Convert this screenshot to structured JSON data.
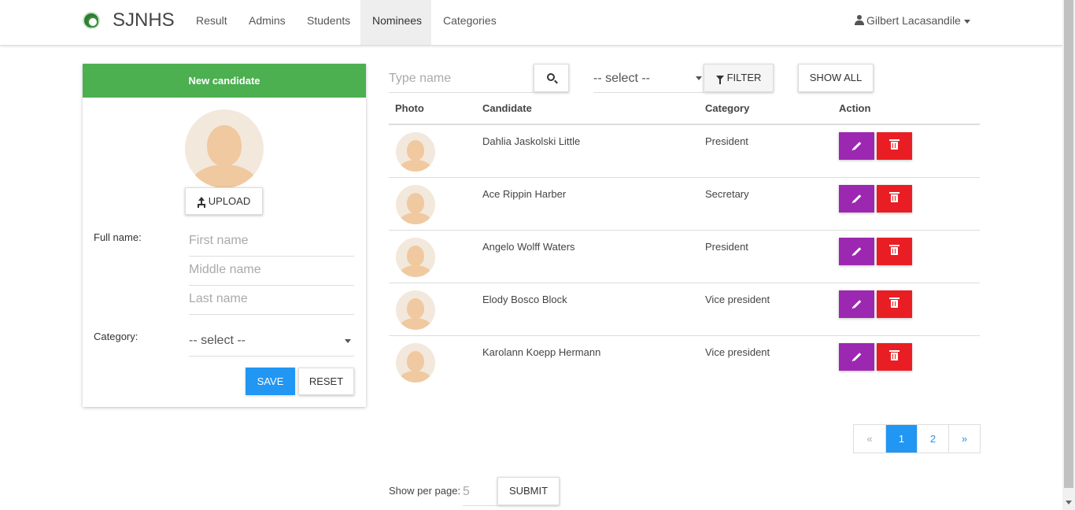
{
  "navbar": {
    "brand": "SJNHS",
    "items": [
      {
        "label": "Result",
        "active": false
      },
      {
        "label": "Admins",
        "active": false
      },
      {
        "label": "Students",
        "active": false
      },
      {
        "label": "Nominees",
        "active": true
      },
      {
        "label": "Categories",
        "active": false
      }
    ],
    "user": "Gilbert Lacasandile"
  },
  "form": {
    "header": "New candidate",
    "upload_label": "UPLOAD",
    "fullname_label": "Full name:",
    "first_placeholder": "First name",
    "middle_placeholder": "Middle name",
    "last_placeholder": "Last name",
    "category_label": "Category:",
    "category_value": "-- select --",
    "save_label": "SAVE",
    "reset_label": "RESET"
  },
  "toolbar": {
    "search_placeholder": "Type name",
    "filter_value": "-- select --",
    "filter_label": "FILTER",
    "showall_label": "SHOW ALL"
  },
  "table": {
    "headers": [
      "Photo",
      "Candidate",
      "Category",
      "Action"
    ],
    "rows": [
      {
        "name": "Dahlia Jaskolski Little",
        "category": "President"
      },
      {
        "name": "Ace Rippin Harber",
        "category": "Secretary"
      },
      {
        "name": "Angelo Wolff Waters",
        "category": "President"
      },
      {
        "name": "Elody Bosco Block",
        "category": "Vice president"
      },
      {
        "name": "Karolann Koepp Hermann",
        "category": "Vice president"
      }
    ]
  },
  "pagination": {
    "prev": "«",
    "pages": [
      "1",
      "2"
    ],
    "current": "1",
    "next": "»"
  },
  "footer": {
    "perpage_label": "Show per page:",
    "perpage_value": "5",
    "submit_label": "SUBMIT"
  },
  "colors": {
    "header_green": "#4caf50",
    "primary_blue": "#2196f3",
    "edit_purple": "#9c27b0",
    "delete_red": "#e91e24"
  }
}
